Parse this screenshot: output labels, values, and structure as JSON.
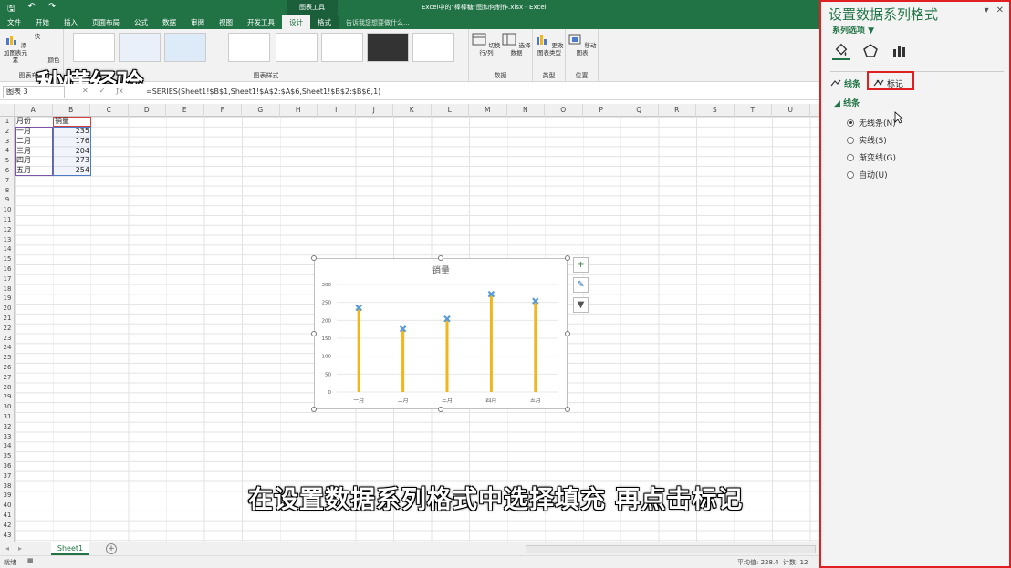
{
  "window": {
    "context_title": "图表工具",
    "doc_title": "Excel中的\"棒棒糖\"图如何制作.xlsx - Excel",
    "tell_me": "告诉我您想要做什么..."
  },
  "tabs": [
    "文件",
    "开始",
    "插入",
    "页面布局",
    "公式",
    "数据",
    "审阅",
    "视图",
    "开发工具",
    "设计",
    "格式"
  ],
  "active_tab": "设计",
  "ribbon": {
    "add_element": "添加图表元素",
    "quick_layout": "快",
    "change_colors": "颜色",
    "group_layout": "图表布局",
    "group_styles": "图表样式",
    "switch_row_col": "切换行/列",
    "select_data": "选择数据",
    "group_data": "数据",
    "change_type": "更改图表类型",
    "group_type": "类型",
    "move_chart": "移动图表",
    "group_location": "位置"
  },
  "formula_bar": {
    "name_box": "图表 3",
    "formula": "=SERIES(Sheet1!$B$1,Sheet1!$A$2:$A$6,Sheet1!$B$2:$B$6,1)"
  },
  "columns": [
    "A",
    "B",
    "C",
    "D",
    "E",
    "F",
    "G",
    "H",
    "I",
    "J",
    "K",
    "L",
    "M",
    "N",
    "O",
    "P",
    "Q",
    "R",
    "S",
    "T",
    "U"
  ],
  "rows": [
    "1",
    "2",
    "3",
    "4",
    "5",
    "6",
    "7",
    "8",
    "9",
    "10",
    "11",
    "12",
    "13",
    "14",
    "15",
    "16",
    "17",
    "18",
    "19",
    "20",
    "21",
    "22",
    "23",
    "24",
    "25",
    "26",
    "27",
    "28",
    "29",
    "30",
    "31",
    "32",
    "33",
    "34",
    "35",
    "36",
    "37",
    "38",
    "39",
    "40",
    "41",
    "42",
    "43"
  ],
  "table": {
    "header_a": "月份",
    "header_b": "销量",
    "cells": [
      {
        "month": "一月",
        "value": "235"
      },
      {
        "month": "二月",
        "value": "176"
      },
      {
        "month": "三月",
        "value": "204"
      },
      {
        "month": "四月",
        "value": "273"
      },
      {
        "month": "五月",
        "value": "254"
      }
    ]
  },
  "chart_data": {
    "type": "bar",
    "title": "销量",
    "categories": [
      "一月",
      "二月",
      "三月",
      "四月",
      "五月"
    ],
    "values": [
      235,
      176,
      204,
      273,
      254
    ],
    "ylim": [
      0,
      300
    ],
    "yticks": [
      "0",
      "50",
      "100",
      "150",
      "200",
      "250",
      "300"
    ],
    "grid": true,
    "bar_color": "#f2b619",
    "marker_color": "#5b9bd5"
  },
  "chart_buttons": {
    "add": "+",
    "brush": "✎",
    "filter": "▼"
  },
  "sheet": {
    "tab": "Sheet1",
    "add": "+"
  },
  "status": {
    "ready": "就绪",
    "average": "平均值: 228.4",
    "count": "计数: 12"
  },
  "pane": {
    "title": "设置数据系列格式",
    "subtitle": "系列选项 ▼",
    "subtab_line": "线条",
    "subtab_marker": "标记",
    "section": "线条",
    "options": [
      {
        "label": "无线条(N)",
        "selected": true
      },
      {
        "label": "实线(S)",
        "selected": false
      },
      {
        "label": "渐变线(G)",
        "selected": false
      },
      {
        "label": "自动(U)",
        "selected": false
      }
    ]
  },
  "overlay": {
    "watermark": "秒懂经验",
    "caption": "在设置数据系列格式中选择填充  再点击标记"
  }
}
